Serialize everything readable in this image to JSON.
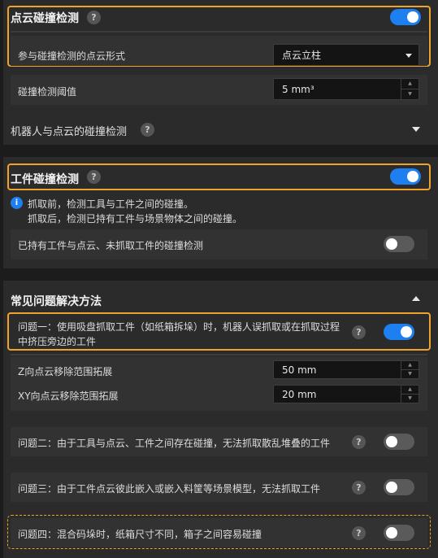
{
  "section1": {
    "title": "点云碰撞检测",
    "toggle_on": true,
    "form_label": "参与碰撞检测的点云形式",
    "form_value": "点云立柱",
    "threshold_label": "碰撞检测阈值",
    "threshold_value": "5 mm³",
    "robot_title": "机器人与点云的碰撞检测"
  },
  "section2": {
    "title": "工件碰撞检测",
    "toggle_on": true,
    "info_line1": "抓取前，检测工具与工件之间的碰撞。",
    "info_line2": "抓取后，检测已持有工件与场景物体之间的碰撞。",
    "held_label": "已持有工件与点云、未抓取工件的碰撞检测",
    "held_toggle_on": false
  },
  "section3": {
    "title": "常见问题解决方法",
    "q1_line1": "问题一：使用吸盘抓取工件（如纸箱拆垛）时，机器人误抓取或在抓取过程",
    "q1_line2": "中挤压旁边的工件",
    "q1_toggle_on": true,
    "z_label": "Z向点云移除范围拓展",
    "z_value": "50 mm",
    "xy_label": "XY向点云移除范围拓展",
    "xy_value": "20 mm",
    "q2": "问题二：由于工具与点云、工件之间存在碰撞，无法抓取散乱堆叠的工件",
    "q2_toggle_on": false,
    "q3": "问题三：由于工件点云彼此嵌入或嵌入料筐等场景模型，无法抓取工件",
    "q3_toggle_on": false,
    "q4": "问题四：混合码垛时，纸箱尺寸不同，箱子之间容易碰撞",
    "q4_toggle_on": false
  },
  "help_glyph": "?",
  "info_glyph": "i",
  "colors": {
    "accent": "#1e7ff0",
    "highlight": "#f0a32a",
    "panel": "#2b2b2b",
    "background": "#1c1c1c"
  }
}
